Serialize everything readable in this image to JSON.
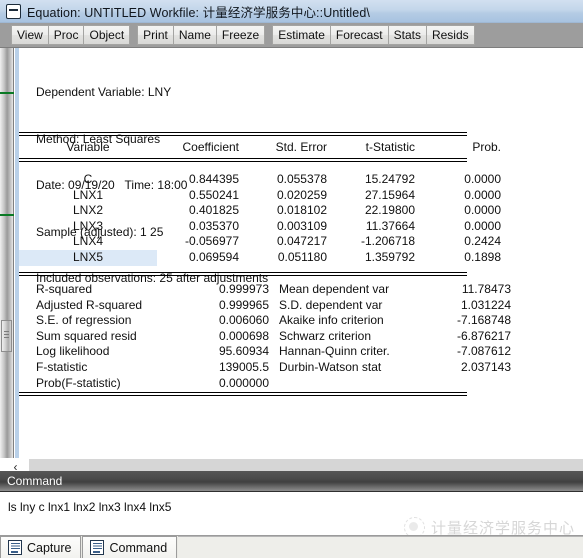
{
  "window": {
    "icon": "equation-window-icon",
    "title": "Equation: UNTITLED   Workfile: 计量经济学服务中心::Untitled\\"
  },
  "toolbar": {
    "groups": [
      [
        "View",
        "Proc",
        "Object"
      ],
      [
        "Print",
        "Name",
        "Freeze"
      ],
      [
        "Estimate",
        "Forecast",
        "Stats",
        "Resids"
      ]
    ]
  },
  "output": {
    "header_lines": [
      "Dependent Variable: LNY",
      "Method: Least Squares",
      "Date: 09/19/20   Time: 18:00",
      "Sample (adjusted): 1 25",
      "Included observations: 25 after adjustments"
    ],
    "columns": [
      "Variable",
      "Coefficient",
      "Std. Error",
      "t-Statistic",
      "Prob."
    ],
    "rows": [
      {
        "variable": "C",
        "coefficient": "0.844395",
        "std_error": "0.055378",
        "t_statistic": "15.24792",
        "prob": "0.0000",
        "highlighted": false
      },
      {
        "variable": "LNX1",
        "coefficient": "0.550241",
        "std_error": "0.020259",
        "t_statistic": "27.15964",
        "prob": "0.0000",
        "highlighted": false
      },
      {
        "variable": "LNX2",
        "coefficient": "0.401825",
        "std_error": "0.018102",
        "t_statistic": "22.19800",
        "prob": "0.0000",
        "highlighted": false
      },
      {
        "variable": "LNX3",
        "coefficient": "0.035370",
        "std_error": "0.003109",
        "t_statistic": "11.37664",
        "prob": "0.0000",
        "highlighted": false
      },
      {
        "variable": "LNX4",
        "coefficient": "-0.056977",
        "std_error": "0.047217",
        "t_statistic": "-1.206718",
        "prob": "0.2424",
        "highlighted": false
      },
      {
        "variable": "LNX5",
        "coefficient": "0.069594",
        "std_error": "0.051180",
        "t_statistic": "1.359792",
        "prob": "0.1898",
        "highlighted": true
      }
    ],
    "stats": [
      {
        "label": "R-squared",
        "value": "0.999973",
        "label2": "Mean dependent var",
        "value2": "11.78473"
      },
      {
        "label": "Adjusted R-squared",
        "value": "0.999965",
        "label2": "S.D. dependent var",
        "value2": "1.031224"
      },
      {
        "label": "S.E. of regression",
        "value": "0.006060",
        "label2": "Akaike info criterion",
        "value2": "-7.168748"
      },
      {
        "label": "Sum squared resid",
        "value": "0.000698",
        "label2": "Schwarz criterion",
        "value2": "-6.876217"
      },
      {
        "label": "Log likelihood",
        "value": "95.60934",
        "label2": "Hannan-Quinn criter.",
        "value2": "-7.087612"
      },
      {
        "label": "F-statistic",
        "value": "139005.5",
        "label2": "Durbin-Watson stat",
        "value2": "2.037143"
      },
      {
        "label": "Prob(F-statistic)",
        "value": "0.000000",
        "label2": "",
        "value2": ""
      }
    ]
  },
  "hscroll": {
    "left_arrow": "‹"
  },
  "command": {
    "panel_title": "Command",
    "line": "ls lny c lnx1 lnx2 lnx3 lnx4 lnx5"
  },
  "watermark": {
    "text": "计量经济学服务中心"
  },
  "tabs": [
    {
      "label": "Capture",
      "active": false
    },
    {
      "label": "Command",
      "active": true
    }
  ]
}
